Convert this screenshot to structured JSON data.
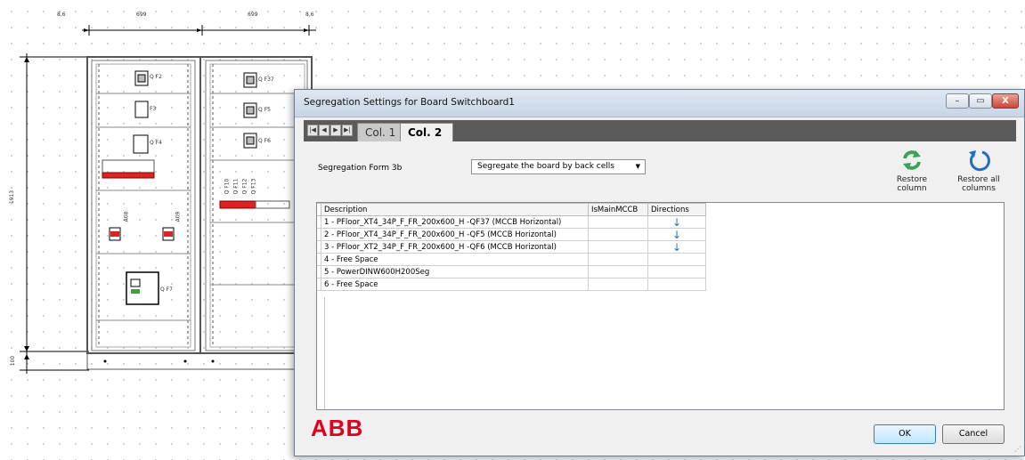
{
  "drawing": {
    "dim_top": [
      "8,6",
      "699",
      "699",
      "8,6"
    ],
    "dim_height": "1913",
    "dim_base": "100",
    "breakers": [
      "Q F2",
      "Q F37",
      "F3",
      "Q F5",
      "Q F4",
      "Q F6",
      "Q F7"
    ],
    "vertical_labels": [
      "Q F10",
      "Q F11",
      "Q F12",
      "Q F13",
      "A08",
      "A09"
    ]
  },
  "dialog": {
    "title": "Segregation Settings for Board Switchboard1",
    "window_buttons": {
      "minimize": "–",
      "maximize": "▭",
      "close": "X"
    },
    "nav_buttons": [
      "|◀",
      "◀",
      "▶",
      "▶|"
    ],
    "tabs": [
      {
        "label": "Col. 1"
      },
      {
        "label": "Col. 2",
        "active": true
      }
    ],
    "segregation_label": "Segregation Form 3b",
    "segregation_value": "Segregate the board by back cells",
    "actions": {
      "restore_column": "Restore column",
      "restore_all": "Restore all columns",
      "restore_column_color": "#3aa25a",
      "restore_all_color": "#1f6ec8"
    },
    "columns": [
      "Description",
      "IsMainMCCB",
      "Directions"
    ],
    "rows": [
      {
        "description": "1 - PFloor_XT4_34P_F_FR_200x600_H -QF37 (MCCB Horizontal)",
        "is_main": "",
        "direction": "↓"
      },
      {
        "description": "2 - PFloor_XT4_34P_F_FR_200x600_H -QF5 (MCCB Horizontal)",
        "is_main": "",
        "direction": "↓"
      },
      {
        "description": "3 - PFloor_XT2_34P_F_FR_200x600_H -QF6 (MCCB Horizontal)",
        "is_main": "",
        "direction": "↓"
      },
      {
        "description": "4 - Free Space",
        "is_main": "",
        "direction": ""
      },
      {
        "description": "5 - PowerDINW600H200Seg",
        "is_main": "",
        "direction": ""
      },
      {
        "description": "6 - Free Space",
        "is_main": "",
        "direction": ""
      }
    ],
    "logo": "ABB",
    "ok_label": "OK",
    "cancel_label": "Cancel"
  }
}
